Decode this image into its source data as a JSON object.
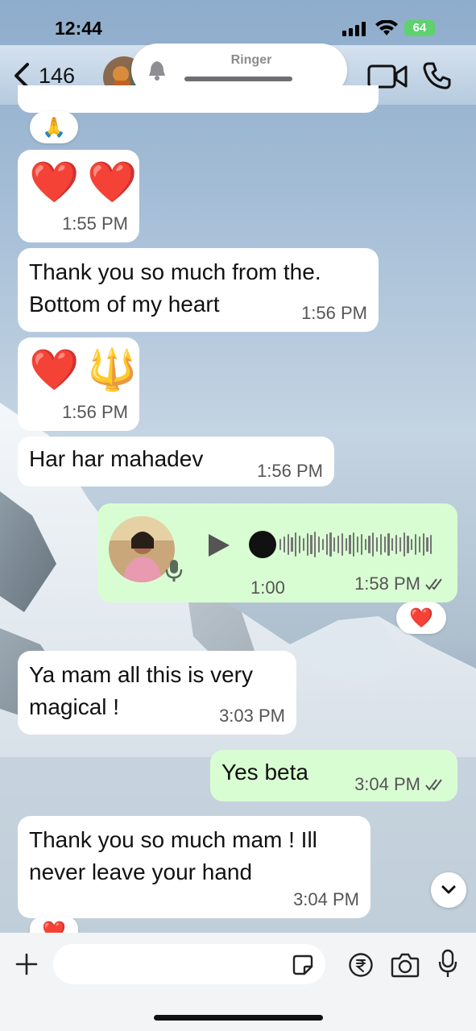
{
  "status_bar": {
    "time": "12:44",
    "battery": "64"
  },
  "header": {
    "back_count": "146",
    "ringer_label": "Ringer"
  },
  "messages": [
    {
      "direction": "in",
      "type": "emoji",
      "emoji": [
        "❤️",
        "❤️"
      ],
      "time": "1:55 PM"
    },
    {
      "direction": "in",
      "type": "text",
      "lines": [
        "Thank you so much from the.",
        "Bottom of my heart"
      ],
      "time": "1:56 PM"
    },
    {
      "direction": "in",
      "type": "emoji",
      "emoji": [
        "❤️",
        "🔱"
      ],
      "time": "1:56 PM"
    },
    {
      "direction": "in",
      "type": "text",
      "lines": [
        "Har har mahadev"
      ],
      "time": "1:56 PM"
    },
    {
      "direction": "out",
      "type": "voice",
      "duration": "1:00",
      "time": "1:58 PM",
      "progress": 0.0,
      "reaction": "❤️"
    },
    {
      "direction": "in",
      "type": "text",
      "lines": [
        "Ya mam all this is very",
        "magical !"
      ],
      "time": "3:03 PM"
    },
    {
      "direction": "out",
      "type": "text",
      "lines": [
        "Yes beta"
      ],
      "time": "3:04 PM"
    },
    {
      "direction": "in",
      "type": "text",
      "lines": [
        "Thank you so much mam ! Ill",
        "never leave your hand"
      ],
      "time": "3:04 PM"
    }
  ],
  "prev_reactions": {
    "top": "🙏",
    "bottom": "❤️"
  },
  "icons": {
    "back": "chevron-left-icon",
    "video": "video-icon",
    "phone": "phone-icon",
    "bell": "bell-icon",
    "plus": "plus-icon",
    "sticker": "sticker-icon",
    "rupee": "rupee-icon",
    "camera": "camera-icon",
    "mic": "mic-icon",
    "scroll": "chevron-down-icon"
  },
  "colors": {
    "incoming_bubble": "#ffffff",
    "outgoing_bubble": "#d9fdd3",
    "read_ticks": "#555555"
  }
}
